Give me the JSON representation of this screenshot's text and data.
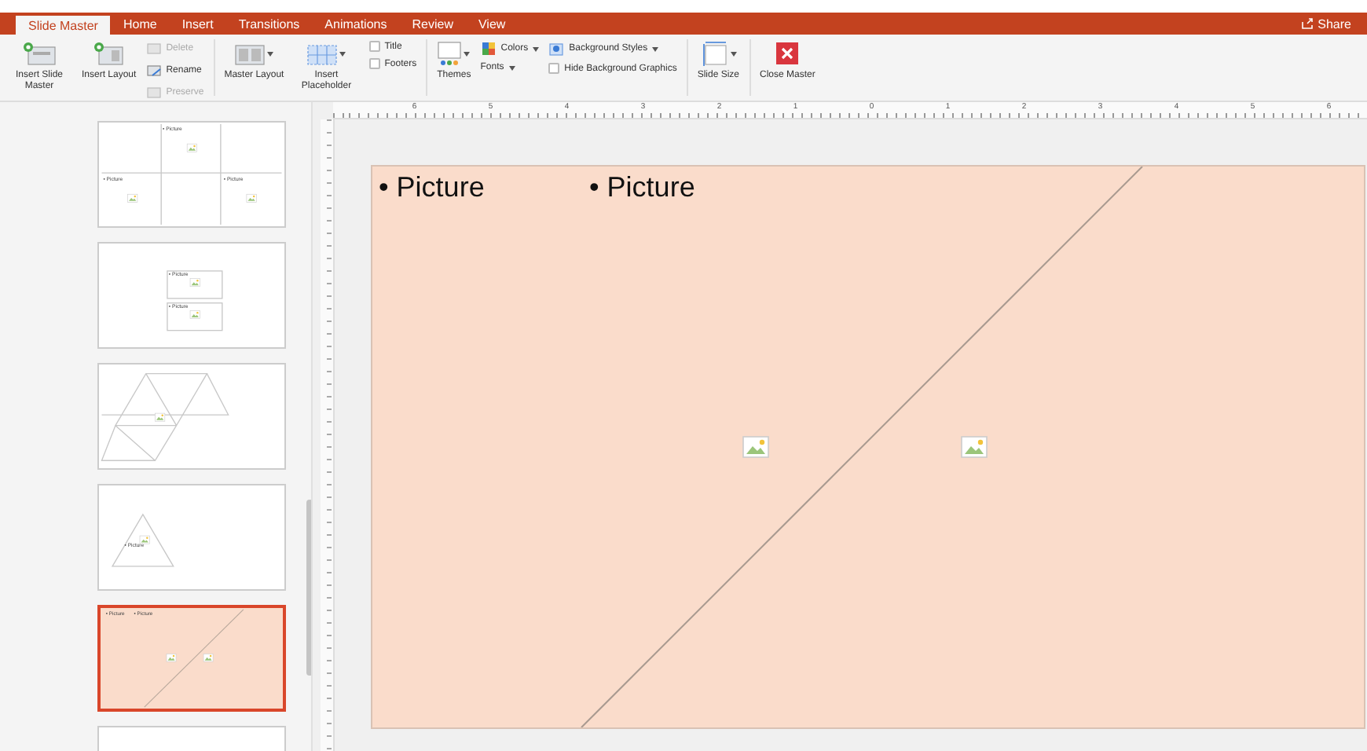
{
  "tabs": [
    {
      "label": "Slide Master",
      "selected": true
    },
    {
      "label": "Home",
      "selected": false
    },
    {
      "label": "Insert",
      "selected": false
    },
    {
      "label": "Transitions",
      "selected": false
    },
    {
      "label": "Animations",
      "selected": false
    },
    {
      "label": "Review",
      "selected": false
    },
    {
      "label": "View",
      "selected": false
    }
  ],
  "share": "Share",
  "ribbon": [
    {
      "kind": "large",
      "label": "Insert Slide Master"
    },
    {
      "kind": "large",
      "label": "Insert Layout"
    },
    {
      "kind": "stack",
      "items": [
        {
          "kind": "small",
          "label": "Delete",
          "disabled": true
        },
        {
          "kind": "small",
          "label": "Rename",
          "disabled": false
        },
        {
          "kind": "small",
          "label": "Preserve",
          "disabled": true
        }
      ]
    },
    {
      "kind": "divider"
    },
    {
      "kind": "large",
      "label": "Master Layout",
      "dropdown": true
    },
    {
      "kind": "large",
      "label": "Insert Placeholder",
      "dropdown": true
    },
    {
      "kind": "stack",
      "items": [
        {
          "kind": "check",
          "label": "Title",
          "checked": false
        },
        {
          "kind": "check",
          "label": "Footers",
          "checked": false
        }
      ]
    },
    {
      "kind": "divider"
    },
    {
      "kind": "large",
      "label": "Themes",
      "dropdown": true
    },
    {
      "kind": "stack",
      "items": [
        {
          "kind": "small",
          "label": "Colors",
          "dropdown": true
        },
        {
          "kind": "small",
          "label": "Fonts",
          "dropdown": true
        }
      ]
    },
    {
      "kind": "stack",
      "items": [
        {
          "kind": "small",
          "label": "Background Styles",
          "dropdown": true
        },
        {
          "kind": "check",
          "label": "Hide Background Graphics",
          "checked": false
        }
      ]
    },
    {
      "kind": "divider"
    },
    {
      "kind": "large",
      "label": "Slide Size",
      "dropdown": true
    },
    {
      "kind": "divider"
    },
    {
      "kind": "large",
      "label": "Close Master"
    }
  ],
  "ruler": [
    "6",
    "5",
    "4",
    "3",
    "2",
    "1",
    "0",
    "1",
    "2",
    "3",
    "4",
    "5",
    "6"
  ],
  "thumbnails": [
    {
      "kind": "grid4",
      "selected": false,
      "labels": [
        "• Picture",
        "• Picture",
        "• Picture"
      ]
    },
    {
      "kind": "stacked2",
      "selected": false,
      "labels": [
        "• Picture",
        "• Picture"
      ]
    },
    {
      "kind": "triangles",
      "selected": false
    },
    {
      "kind": "triangle",
      "selected": false,
      "labels": [
        "• Picture"
      ]
    },
    {
      "kind": "diagonal",
      "selected": true,
      "labels": [
        "• Picture",
        "• Picture"
      ]
    },
    {
      "kind": "blank",
      "selected": false
    }
  ],
  "slide": {
    "kind": "diagonal",
    "labels": [
      "• Picture",
      "• Picture"
    ]
  }
}
